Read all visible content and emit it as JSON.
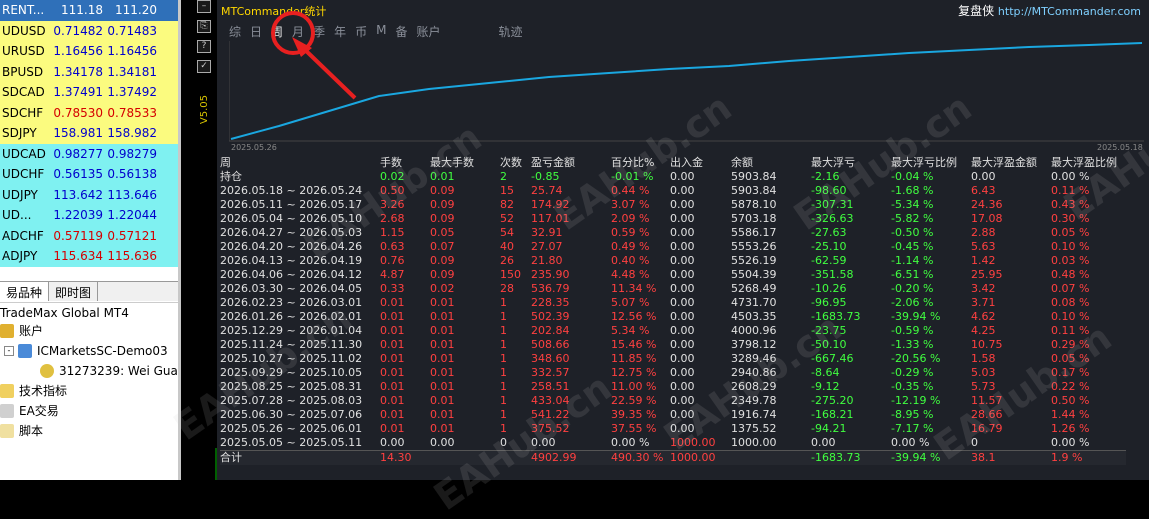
{
  "market_watch": {
    "rows": [
      {
        "symbol": "RENT...",
        "bid": "111.18",
        "ask": "111.20",
        "color": "hl"
      },
      {
        "symbol": "UDUSD",
        "bid": "0.71482",
        "ask": "0.71483",
        "color": "y"
      },
      {
        "symbol": "URUSD",
        "bid": "1.16456",
        "ask": "1.16456",
        "color": "y"
      },
      {
        "symbol": "BPUSD",
        "bid": "1.34178",
        "ask": "1.34181",
        "color": "y"
      },
      {
        "symbol": "SDCAD",
        "bid": "1.37491",
        "ask": "1.37492",
        "color": "y"
      },
      {
        "symbol": "SDCHF",
        "bid": "0.78530",
        "ask": "0.78533",
        "color": "y",
        "red": true
      },
      {
        "symbol": "SDJPY",
        "bid": "158.981",
        "ask": "158.982",
        "color": "y"
      },
      {
        "symbol": "UDCAD",
        "bid": "0.98277",
        "ask": "0.98279",
        "color": "c"
      },
      {
        "symbol": "UDCHF",
        "bid": "0.56135",
        "ask": "0.56138",
        "color": "c"
      },
      {
        "symbol": "UDJPY",
        "bid": "113.642",
        "ask": "113.646",
        "color": "c"
      },
      {
        "symbol": "UD...",
        "bid": "1.22039",
        "ask": "1.22044",
        "color": "c"
      },
      {
        "symbol": "ADCHF",
        "bid": "0.57119",
        "ask": "0.57121",
        "color": "c",
        "red": true
      },
      {
        "symbol": "ADJPY",
        "bid": "115.634",
        "ask": "115.636",
        "color": "c",
        "red": true
      }
    ],
    "tab_symbols": "易品种",
    "tab_tick": "即时图"
  },
  "navigator": {
    "root": "TradeMax Global MT4",
    "accounts": "账户",
    "server": "ICMarketsSC-Demo03",
    "account": "31273239: Wei Gua",
    "indicators": "技术指标",
    "ea": "EA交易",
    "scripts": "脚本"
  },
  "chart": {
    "vertical_label": "V5.05",
    "toolbar": [
      "–",
      "⎘",
      "?",
      "✓"
    ]
  },
  "panel": {
    "title": "MTCommander统计",
    "link_label": "复盘侠",
    "link_url": "http://MTCommander.com",
    "tabs": [
      "综",
      "日",
      "周",
      "月",
      "季",
      "年",
      "币",
      "M",
      "备",
      "账户",
      "",
      "轨迹"
    ],
    "active_tab": 2,
    "graph": {
      "start_label": "2025.05.26",
      "end_label": "2025.05.18"
    },
    "columns": [
      "周",
      "手数",
      "最大手数",
      "次数",
      "盈亏金额",
      "百分比%",
      "出入金",
      "余额",
      "最大浮亏",
      "最大浮亏比例",
      "最大浮盈金额",
      "最大浮盈比例"
    ],
    "holding": {
      "label": "持仓",
      "lots": "0.02",
      "maxlots": "0.01",
      "count": "2",
      "pnl": "-0.85",
      "pct": "-0.01 %",
      "flow": "0.00",
      "balance": "5903.84",
      "maxdd": "-2.16",
      "ddpct": "-0.04 %",
      "maxfp": "0.00",
      "fppct": "0.00 %"
    },
    "rows": [
      [
        "2026.05.18 ~ 2026.05.24",
        "0.50",
        "0.09",
        "15",
        "25.74",
        "0.44 %",
        "0.00",
        "5903.84",
        "-98.60",
        "-1.68 %",
        "6.43",
        "0.11 %"
      ],
      [
        "2026.05.11 ~ 2026.05.17",
        "3.26",
        "0.09",
        "82",
        "174.92",
        "3.07 %",
        "0.00",
        "5878.10",
        "-307.31",
        "-5.34 %",
        "24.36",
        "0.43 %"
      ],
      [
        "2026.05.04 ~ 2026.05.10",
        "2.68",
        "0.09",
        "52",
        "117.01",
        "2.09 %",
        "0.00",
        "5703.18",
        "-326.63",
        "-5.82 %",
        "17.08",
        "0.30 %"
      ],
      [
        "2026.04.27 ~ 2026.05.03",
        "1.15",
        "0.05",
        "54",
        "32.91",
        "0.59 %",
        "0.00",
        "5586.17",
        "-27.63",
        "-0.50 %",
        "2.88",
        "0.05 %"
      ],
      [
        "2026.04.20 ~ 2026.04.26",
        "0.63",
        "0.07",
        "40",
        "27.07",
        "0.49 %",
        "0.00",
        "5553.26",
        "-25.10",
        "-0.45 %",
        "5.63",
        "0.10 %"
      ],
      [
        "2026.04.13 ~ 2026.04.19",
        "0.76",
        "0.09",
        "26",
        "21.80",
        "0.40 %",
        "0.00",
        "5526.19",
        "-62.59",
        "-1.14 %",
        "1.42",
        "0.03 %"
      ],
      [
        "2026.04.06 ~ 2026.04.12",
        "4.87",
        "0.09",
        "150",
        "235.90",
        "4.48 %",
        "0.00",
        "5504.39",
        "-351.58",
        "-6.51 %",
        "25.95",
        "0.48 %"
      ],
      [
        "2026.03.30 ~ 2026.04.05",
        "0.33",
        "0.02",
        "28",
        "536.79",
        "11.34 %",
        "0.00",
        "5268.49",
        "-10.26",
        "-0.20 %",
        "3.42",
        "0.07 %"
      ],
      [
        "2026.02.23 ~ 2026.03.01",
        "0.01",
        "0.01",
        "1",
        "228.35",
        "5.07 %",
        "0.00",
        "4731.70",
        "-96.95",
        "-2.06 %",
        "3.71",
        "0.08 %"
      ],
      [
        "2026.01.26 ~ 2026.02.01",
        "0.01",
        "0.01",
        "1",
        "502.39",
        "12.56 %",
        "0.00",
        "4503.35",
        "-1683.73",
        "-39.94 %",
        "4.62",
        "0.10 %"
      ],
      [
        "2025.12.29 ~ 2026.01.04",
        "0.01",
        "0.01",
        "1",
        "202.84",
        "5.34 %",
        "0.00",
        "4000.96",
        "-23.75",
        "-0.59 %",
        "4.25",
        "0.11 %"
      ],
      [
        "2025.11.24 ~ 2025.11.30",
        "0.01",
        "0.01",
        "1",
        "508.66",
        "15.46 %",
        "0.00",
        "3798.12",
        "-50.10",
        "-1.33 %",
        "10.75",
        "0.29 %"
      ],
      [
        "2025.10.27 ~ 2025.11.02",
        "0.01",
        "0.01",
        "1",
        "348.60",
        "11.85 %",
        "0.00",
        "3289.46",
        "-667.46",
        "-20.56 %",
        "1.58",
        "0.05 %"
      ],
      [
        "2025.09.29 ~ 2025.10.05",
        "0.01",
        "0.01",
        "1",
        "332.57",
        "12.75 %",
        "0.00",
        "2940.86",
        "-8.64",
        "-0.29 %",
        "5.03",
        "0.17 %"
      ],
      [
        "2025.08.25 ~ 2025.08.31",
        "0.01",
        "0.01",
        "1",
        "258.51",
        "11.00 %",
        "0.00",
        "2608.29",
        "-9.12",
        "-0.35 %",
        "5.73",
        "0.22 %"
      ],
      [
        "2025.07.28 ~ 2025.08.03",
        "0.01",
        "0.01",
        "1",
        "433.04",
        "22.59 %",
        "0.00",
        "2349.78",
        "-275.20",
        "-12.19 %",
        "11.57",
        "0.50 %"
      ],
      [
        "2025.06.30 ~ 2025.07.06",
        "0.01",
        "0.01",
        "1",
        "541.22",
        "39.35 %",
        "0.00",
        "1916.74",
        "-168.21",
        "-8.95 %",
        "28.66",
        "1.44 %"
      ],
      [
        "2025.05.26 ~ 2025.06.01",
        "0.01",
        "0.01",
        "1",
        "375.52",
        "37.55 %",
        "0.00",
        "1375.52",
        "-94.21",
        "-7.17 %",
        "16.79",
        "1.26 %"
      ],
      [
        "2025.05.05 ~ 2025.05.11",
        "0.00",
        "0.00",
        "0",
        "0.00",
        "0.00 %",
        "1000.00",
        "1000.00",
        "0.00",
        "0.00 %",
        "0",
        "0.00 %"
      ]
    ],
    "total": [
      "合计",
      "14.30",
      "",
      "",
      "4902.99",
      "490.30 %",
      "1000.00",
      "",
      "-1683.73",
      "-39.94 %",
      "38.1",
      "1.9 %"
    ]
  },
  "watermark": "EAHub.cn",
  "colors": {
    "accent_red": "#e82020",
    "line": "#1aa7e0",
    "panel_bg": "#1e2128",
    "pos": "#ff4040",
    "neg": "#40ff40"
  }
}
